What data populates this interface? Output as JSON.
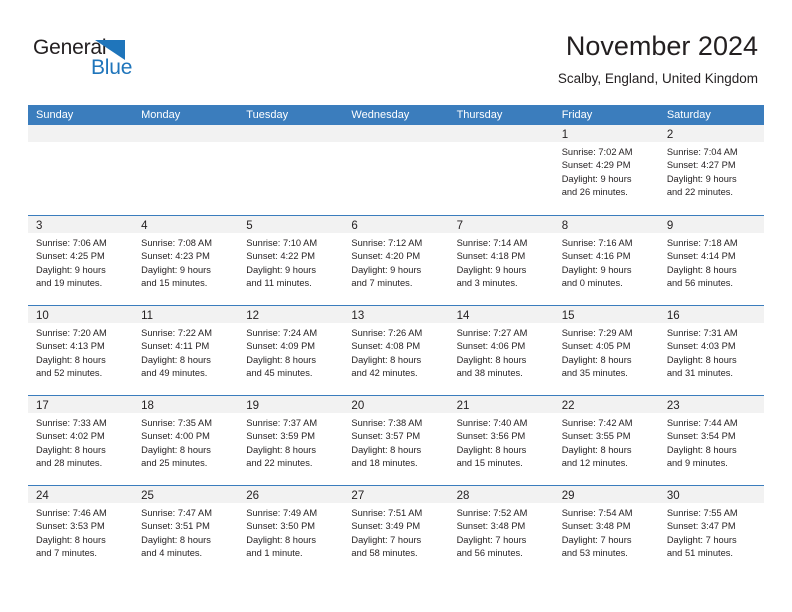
{
  "brand": {
    "name_part1": "General",
    "name_part2": "Blue",
    "accent_color": "#1f75bb"
  },
  "header": {
    "title": "November 2024",
    "subtitle": "Scalby, England, United Kingdom"
  },
  "theme": {
    "header_blue": "#3b7dbd",
    "date_band_gray": "#f2f2f2",
    "text_color": "#231f20"
  },
  "calendar": {
    "day_headers": [
      "Sunday",
      "Monday",
      "Tuesday",
      "Wednesday",
      "Thursday",
      "Friday",
      "Saturday"
    ],
    "weeks": [
      [
        {
          "day": "",
          "lines": []
        },
        {
          "day": "",
          "lines": []
        },
        {
          "day": "",
          "lines": []
        },
        {
          "day": "",
          "lines": []
        },
        {
          "day": "",
          "lines": []
        },
        {
          "day": "1",
          "lines": [
            "Sunrise: 7:02 AM",
            "Sunset: 4:29 PM",
            "Daylight: 9 hours",
            "and 26 minutes."
          ]
        },
        {
          "day": "2",
          "lines": [
            "Sunrise: 7:04 AM",
            "Sunset: 4:27 PM",
            "Daylight: 9 hours",
            "and 22 minutes."
          ]
        }
      ],
      [
        {
          "day": "3",
          "lines": [
            "Sunrise: 7:06 AM",
            "Sunset: 4:25 PM",
            "Daylight: 9 hours",
            "and 19 minutes."
          ]
        },
        {
          "day": "4",
          "lines": [
            "Sunrise: 7:08 AM",
            "Sunset: 4:23 PM",
            "Daylight: 9 hours",
            "and 15 minutes."
          ]
        },
        {
          "day": "5",
          "lines": [
            "Sunrise: 7:10 AM",
            "Sunset: 4:22 PM",
            "Daylight: 9 hours",
            "and 11 minutes."
          ]
        },
        {
          "day": "6",
          "lines": [
            "Sunrise: 7:12 AM",
            "Sunset: 4:20 PM",
            "Daylight: 9 hours",
            "and 7 minutes."
          ]
        },
        {
          "day": "7",
          "lines": [
            "Sunrise: 7:14 AM",
            "Sunset: 4:18 PM",
            "Daylight: 9 hours",
            "and 3 minutes."
          ]
        },
        {
          "day": "8",
          "lines": [
            "Sunrise: 7:16 AM",
            "Sunset: 4:16 PM",
            "Daylight: 9 hours",
            "and 0 minutes."
          ]
        },
        {
          "day": "9",
          "lines": [
            "Sunrise: 7:18 AM",
            "Sunset: 4:14 PM",
            "Daylight: 8 hours",
            "and 56 minutes."
          ]
        }
      ],
      [
        {
          "day": "10",
          "lines": [
            "Sunrise: 7:20 AM",
            "Sunset: 4:13 PM",
            "Daylight: 8 hours",
            "and 52 minutes."
          ]
        },
        {
          "day": "11",
          "lines": [
            "Sunrise: 7:22 AM",
            "Sunset: 4:11 PM",
            "Daylight: 8 hours",
            "and 49 minutes."
          ]
        },
        {
          "day": "12",
          "lines": [
            "Sunrise: 7:24 AM",
            "Sunset: 4:09 PM",
            "Daylight: 8 hours",
            "and 45 minutes."
          ]
        },
        {
          "day": "13",
          "lines": [
            "Sunrise: 7:26 AM",
            "Sunset: 4:08 PM",
            "Daylight: 8 hours",
            "and 42 minutes."
          ]
        },
        {
          "day": "14",
          "lines": [
            "Sunrise: 7:27 AM",
            "Sunset: 4:06 PM",
            "Daylight: 8 hours",
            "and 38 minutes."
          ]
        },
        {
          "day": "15",
          "lines": [
            "Sunrise: 7:29 AM",
            "Sunset: 4:05 PM",
            "Daylight: 8 hours",
            "and 35 minutes."
          ]
        },
        {
          "day": "16",
          "lines": [
            "Sunrise: 7:31 AM",
            "Sunset: 4:03 PM",
            "Daylight: 8 hours",
            "and 31 minutes."
          ]
        }
      ],
      [
        {
          "day": "17",
          "lines": [
            "Sunrise: 7:33 AM",
            "Sunset: 4:02 PM",
            "Daylight: 8 hours",
            "and 28 minutes."
          ]
        },
        {
          "day": "18",
          "lines": [
            "Sunrise: 7:35 AM",
            "Sunset: 4:00 PM",
            "Daylight: 8 hours",
            "and 25 minutes."
          ]
        },
        {
          "day": "19",
          "lines": [
            "Sunrise: 7:37 AM",
            "Sunset: 3:59 PM",
            "Daylight: 8 hours",
            "and 22 minutes."
          ]
        },
        {
          "day": "20",
          "lines": [
            "Sunrise: 7:38 AM",
            "Sunset: 3:57 PM",
            "Daylight: 8 hours",
            "and 18 minutes."
          ]
        },
        {
          "day": "21",
          "lines": [
            "Sunrise: 7:40 AM",
            "Sunset: 3:56 PM",
            "Daylight: 8 hours",
            "and 15 minutes."
          ]
        },
        {
          "day": "22",
          "lines": [
            "Sunrise: 7:42 AM",
            "Sunset: 3:55 PM",
            "Daylight: 8 hours",
            "and 12 minutes."
          ]
        },
        {
          "day": "23",
          "lines": [
            "Sunrise: 7:44 AM",
            "Sunset: 3:54 PM",
            "Daylight: 8 hours",
            "and 9 minutes."
          ]
        }
      ],
      [
        {
          "day": "24",
          "lines": [
            "Sunrise: 7:46 AM",
            "Sunset: 3:53 PM",
            "Daylight: 8 hours",
            "and 7 minutes."
          ]
        },
        {
          "day": "25",
          "lines": [
            "Sunrise: 7:47 AM",
            "Sunset: 3:51 PM",
            "Daylight: 8 hours",
            "and 4 minutes."
          ]
        },
        {
          "day": "26",
          "lines": [
            "Sunrise: 7:49 AM",
            "Sunset: 3:50 PM",
            "Daylight: 8 hours",
            "and 1 minute."
          ]
        },
        {
          "day": "27",
          "lines": [
            "Sunrise: 7:51 AM",
            "Sunset: 3:49 PM",
            "Daylight: 7 hours",
            "and 58 minutes."
          ]
        },
        {
          "day": "28",
          "lines": [
            "Sunrise: 7:52 AM",
            "Sunset: 3:48 PM",
            "Daylight: 7 hours",
            "and 56 minutes."
          ]
        },
        {
          "day": "29",
          "lines": [
            "Sunrise: 7:54 AM",
            "Sunset: 3:48 PM",
            "Daylight: 7 hours",
            "and 53 minutes."
          ]
        },
        {
          "day": "30",
          "lines": [
            "Sunrise: 7:55 AM",
            "Sunset: 3:47 PM",
            "Daylight: 7 hours",
            "and 51 minutes."
          ]
        }
      ]
    ]
  }
}
